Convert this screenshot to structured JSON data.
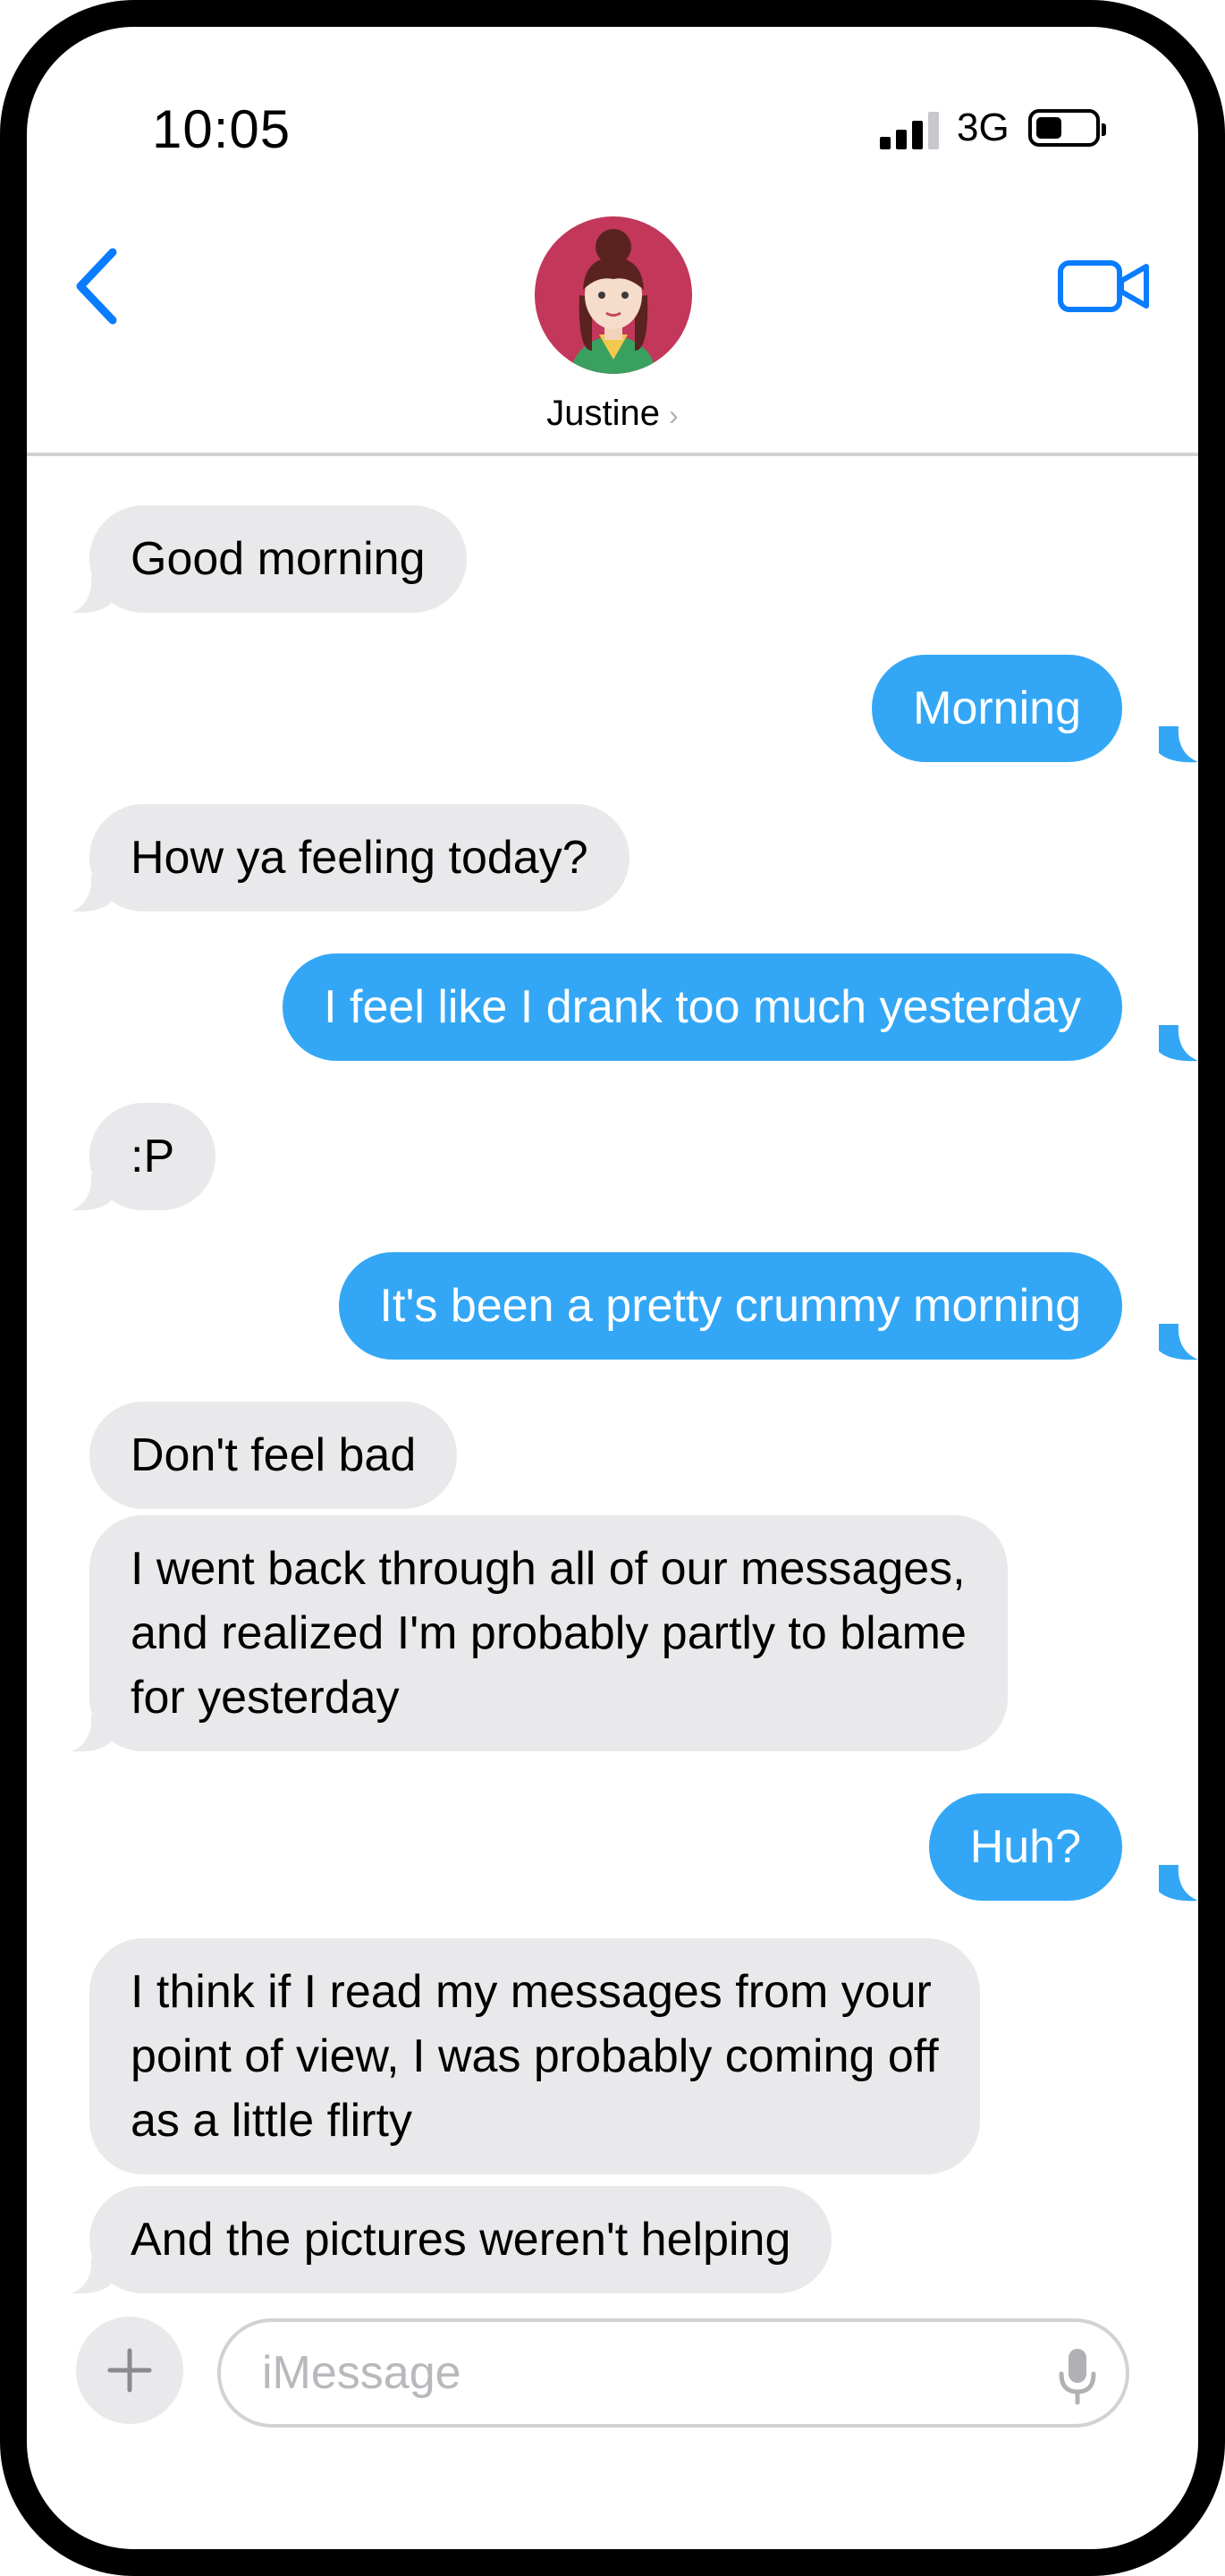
{
  "status_bar": {
    "time": "10:05",
    "network": "3G"
  },
  "header": {
    "contact_name": "Justine",
    "contact_chevron": "›"
  },
  "messages": [
    {
      "direction": "incoming",
      "text": "Good morning"
    },
    {
      "direction": "outgoing",
      "text": "Morning"
    },
    {
      "direction": "incoming",
      "text": "How ya feeling today?"
    },
    {
      "direction": "outgoing",
      "text": "I feel like I drank too much yesterday"
    },
    {
      "direction": "incoming",
      "text": ":P"
    },
    {
      "direction": "outgoing",
      "text": "It's been a pretty crummy morning"
    },
    {
      "direction": "incoming",
      "text": "Don't feel bad"
    },
    {
      "direction": "incoming",
      "text": "I went back through all of our messages,\nand realized I'm probably partly to blame\nfor yesterday"
    },
    {
      "direction": "outgoing",
      "text": "Huh?"
    },
    {
      "direction": "incoming",
      "text": "I think if I read my messages from your\npoint of view, I was probably coming off\nas a little flirty"
    },
    {
      "direction": "incoming",
      "text": "And the pictures weren't helping"
    }
  ],
  "composer": {
    "placeholder": "iMessage",
    "value": ""
  },
  "icons": {
    "back": "chevron-left-icon",
    "video": "video-camera-icon",
    "plus": "plus-icon",
    "mic": "microphone-icon",
    "signal": "cellular-signal-icon",
    "battery": "battery-icon"
  },
  "colors": {
    "accent": "#0a7cff",
    "outgoing_bubble": "#33a7f5",
    "incoming_bubble": "#e9e9eb",
    "divider": "#d2d2d6",
    "avatar_bg": "#c2375a"
  }
}
